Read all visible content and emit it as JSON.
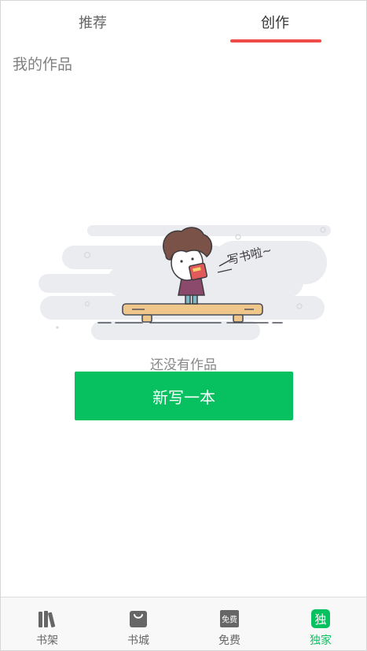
{
  "tabs": [
    {
      "label": "推荐",
      "active": false
    },
    {
      "label": "创作",
      "active": true
    }
  ],
  "accent_color": "#ef4b48",
  "section": {
    "title": "我的作品"
  },
  "illustration": {
    "speech_text": "写书啦~"
  },
  "empty_state": {
    "message": "还没有作品"
  },
  "primary_button": {
    "label": "新写一本",
    "color": "#07c160"
  },
  "bottom_nav": {
    "items": [
      {
        "label": "书架",
        "icon": "bookshelf-icon",
        "active": false
      },
      {
        "label": "书城",
        "icon": "bookstore-bag-icon",
        "active": false
      },
      {
        "label": "免费",
        "icon": "free-tag-icon",
        "icon_text": "免费",
        "active": false
      },
      {
        "label": "独家",
        "icon": "exclusive-icon",
        "icon_text": "独",
        "active": true
      }
    ]
  }
}
